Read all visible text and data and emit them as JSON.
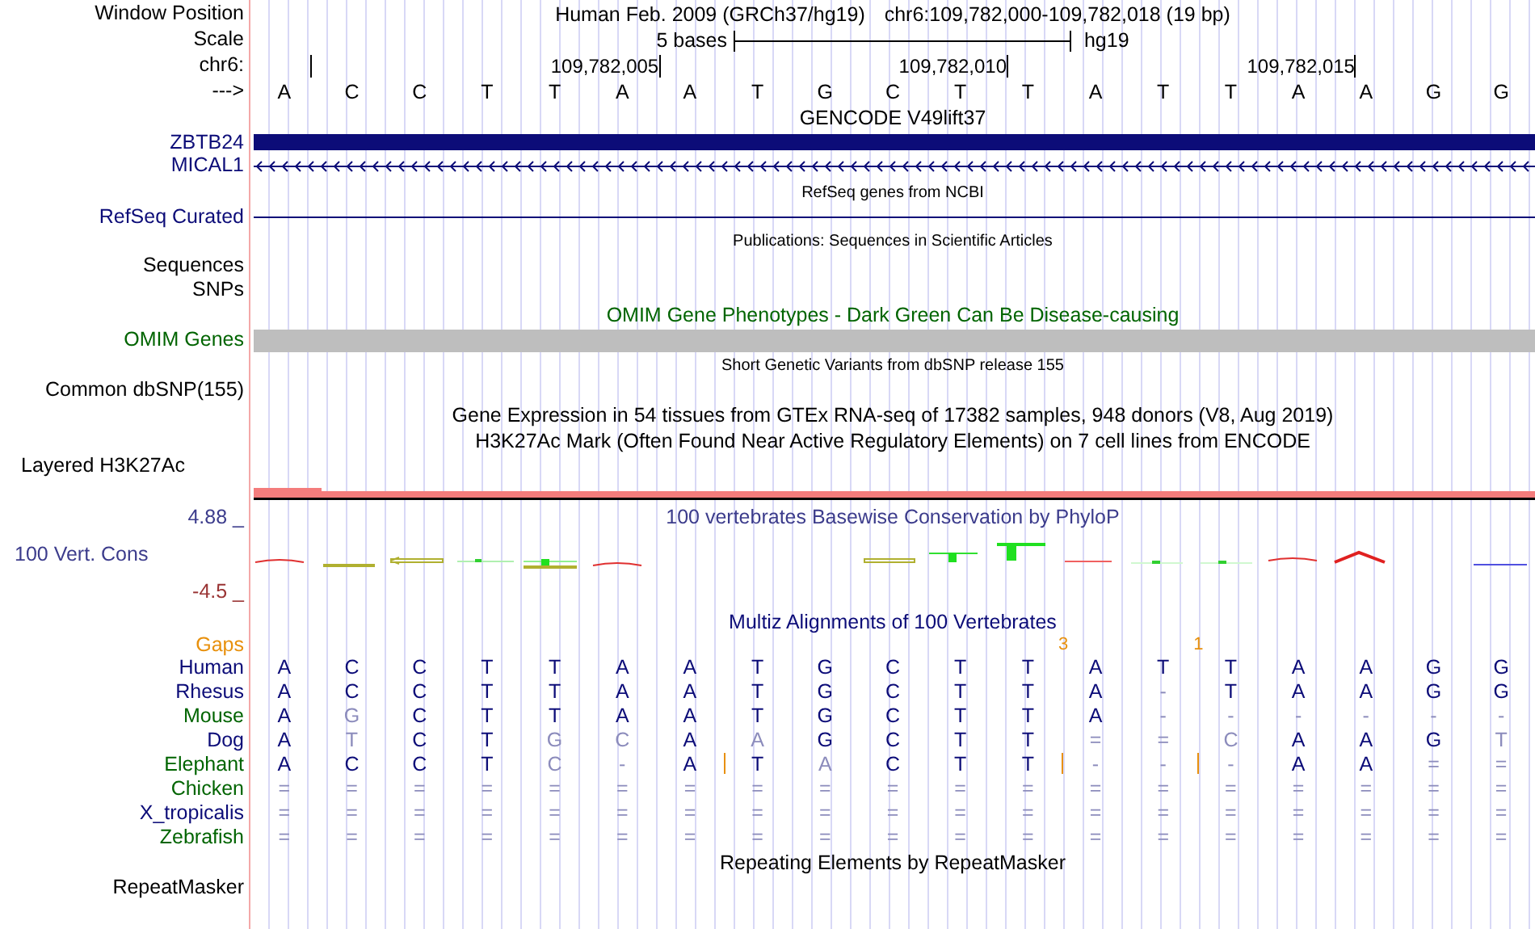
{
  "header": {
    "label": "Window Position",
    "assembly": "Human Feb. 2009 (GRCh37/hg19)",
    "position": "chr6:109,782,000-109,782,018 (19 bp)"
  },
  "scale": {
    "label": "Scale",
    "span": "5 bases",
    "assembly": "hg19"
  },
  "ruler": {
    "label": "chr6:",
    "ticks": [
      {
        "tick": true
      },
      {
        "tick": false
      },
      {
        "tick": false
      },
      {
        "tick": false
      },
      {
        "tick": false
      },
      {
        "tick": true,
        "label": "109,782,005"
      },
      {
        "tick": false
      },
      {
        "tick": false
      },
      {
        "tick": false
      },
      {
        "tick": false
      },
      {
        "tick": true,
        "label": "109,782,010"
      },
      {
        "tick": false
      },
      {
        "tick": false
      },
      {
        "tick": false
      },
      {
        "tick": false
      },
      {
        "tick": true,
        "label": "109,782,015"
      },
      {
        "tick": false
      },
      {
        "tick": false
      },
      {
        "tick": false
      }
    ]
  },
  "strand": {
    "label": "--->",
    "bases": [
      "A",
      "C",
      "C",
      "T",
      "T",
      "A",
      "A",
      "T",
      "G",
      "C",
      "T",
      "T",
      "A",
      "T",
      "T",
      "A",
      "A",
      "G",
      "G"
    ]
  },
  "tracks": [
    {
      "kind": "title",
      "text": "GENCODE V49lift37",
      "color": "#000000"
    },
    {
      "kind": "exon",
      "label": "ZBTB24",
      "color": "#0c0c78"
    },
    {
      "kind": "intron",
      "label": "MICAL1",
      "color": "#0c0c78"
    },
    {
      "kind": "caption",
      "text": "RefSeq genes from NCBI",
      "color": "#000000"
    },
    {
      "kind": "line",
      "label": "RefSeq Curated",
      "color": "#0c0c78"
    },
    {
      "kind": "caption",
      "text": "Publications: Sequences in Scientific Articles",
      "color": "#000000"
    },
    {
      "kind": "label",
      "label": "Sequences",
      "color": "#000000"
    },
    {
      "kind": "label",
      "label": "SNPs",
      "color": "#000000"
    },
    {
      "kind": "title",
      "text": "OMIM Gene Phenotypes - Dark Green Can Be Disease-causing",
      "color": "#006400"
    },
    {
      "kind": "bar",
      "label": "OMIM Genes",
      "color": "#006400"
    },
    {
      "kind": "caption",
      "text": "Short Genetic Variants from dbSNP release 155",
      "color": "#000000"
    },
    {
      "kind": "label",
      "label": "Common dbSNP(155)",
      "color": "#000000"
    },
    {
      "kind": "title",
      "text": "Gene Expression in 54 tissues from GTEx RNA-seq of 17382 samples, 948 donors (V8, Aug 2019)",
      "color": "#000000"
    },
    {
      "kind": "title",
      "text": "H3K27Ac Mark (Often Found Near Active Regulatory Elements) on 7 cell lines from ENCODE",
      "color": "#000000"
    },
    {
      "kind": "layered",
      "label": "Layered H3K27Ac",
      "color": "#000000"
    },
    {
      "kind": "wiggle",
      "label": "100 Vert. Cons",
      "color": "#3c3c8c",
      "title": "100 vertebrates Basewise Conservation by PhyloP",
      "max_label": "4.88 _",
      "min_label": "-4.5 _"
    },
    {
      "kind": "title",
      "text": "Multiz Alignments of 100 Vertebrates",
      "color": "#0c0c78"
    }
  ],
  "multiz": {
    "gaps_label": "Gaps",
    "gaps": [
      {
        "gap": false
      },
      {
        "gap": false
      },
      {
        "gap": false
      },
      {
        "gap": false
      },
      {
        "gap": false
      },
      {
        "gap": false
      },
      {
        "gap": false
      },
      {
        "gap": false
      },
      {
        "gap": false
      },
      {
        "gap": false
      },
      {
        "gap": false
      },
      {
        "gap": true,
        "count": "3"
      },
      {
        "gap": false
      },
      {
        "gap": true,
        "count": "1"
      },
      {
        "gap": false
      },
      {
        "gap": false
      },
      {
        "gap": false
      },
      {
        "gap": false
      },
      {
        "gap": false
      }
    ],
    "species": [
      {
        "name": "Human",
        "color": "#0c0c78",
        "bases": [
          "A",
          "C",
          "C",
          "T",
          "T",
          "A",
          "A",
          "T",
          "G",
          "C",
          "T",
          "T",
          "A",
          "T",
          "T",
          "A",
          "A",
          "G",
          "G"
        ]
      },
      {
        "name": "Rhesus",
        "color": "#0c0c78",
        "bases": [
          "A",
          "C",
          "C",
          "T",
          "T",
          "A",
          "A",
          "T",
          "G",
          "C",
          "T",
          "T",
          "A",
          "-",
          "T",
          "A",
          "A",
          "G",
          "G"
        ]
      },
      {
        "name": "Mouse",
        "color": "#006400",
        "bases": [
          "A",
          "G",
          "C",
          "T",
          "T",
          "A",
          "A",
          "T",
          "G",
          "C",
          "T",
          "T",
          "A",
          "-",
          "-",
          "-",
          "-",
          "-",
          "-"
        ]
      },
      {
        "name": "Dog",
        "color": "#0c0c78",
        "bases": [
          "A",
          "T",
          "C",
          "T",
          "G",
          "C",
          "A",
          "A",
          "G",
          "C",
          "T",
          "T",
          "=",
          "=",
          "C",
          "A",
          "A",
          "G",
          "T"
        ]
      },
      {
        "name": "Elephant",
        "color": "#006400",
        "bases": [
          "A",
          "C",
          "C",
          "T",
          "C",
          "-",
          "A",
          "T",
          "A",
          "C",
          "T",
          "T",
          "-",
          "-",
          "-",
          "A",
          "A",
          "=",
          "="
        ],
        "inserts": [
          false,
          false,
          false,
          false,
          false,
          false,
          true,
          false,
          false,
          false,
          false,
          true,
          false,
          true,
          false,
          false,
          false,
          false,
          false
        ]
      },
      {
        "name": "Chicken",
        "color": "#006400",
        "bases": [
          "=",
          "=",
          "=",
          "=",
          "=",
          "=",
          "=",
          "=",
          "=",
          "=",
          "=",
          "=",
          "=",
          "=",
          "=",
          "=",
          "=",
          "=",
          "="
        ]
      },
      {
        "name": "X_tropicalis",
        "color": "#0c0c78",
        "bases": [
          "=",
          "=",
          "=",
          "=",
          "=",
          "=",
          "=",
          "=",
          "=",
          "=",
          "=",
          "=",
          "=",
          "=",
          "=",
          "=",
          "=",
          "=",
          "="
        ]
      },
      {
        "name": "Zebrafish",
        "color": "#006400",
        "bases": [
          "=",
          "=",
          "=",
          "=",
          "=",
          "=",
          "=",
          "=",
          "=",
          "=",
          "=",
          "=",
          "=",
          "=",
          "=",
          "=",
          "=",
          "=",
          "="
        ]
      }
    ]
  },
  "repeats": {
    "title": "Repeating Elements by RepeatMasker",
    "label": "RepeatMasker"
  }
}
